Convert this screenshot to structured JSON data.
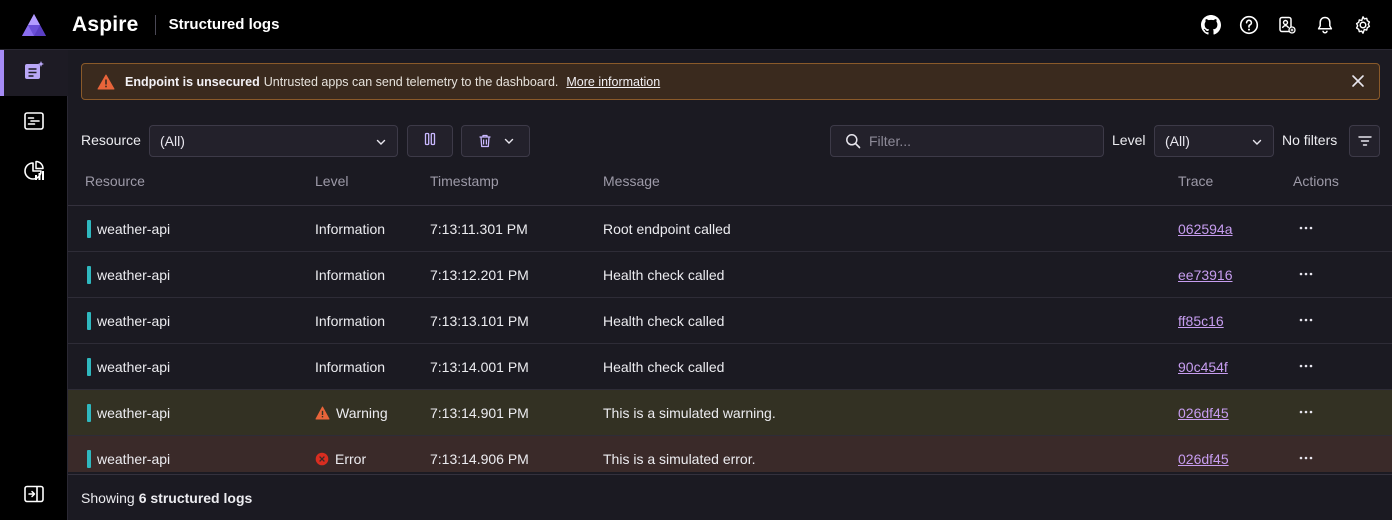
{
  "app": {
    "title": "Aspire",
    "page": "Structured logs"
  },
  "topbar_icons": [
    "github-icon",
    "help-icon",
    "settings-user-icon",
    "notification-bell-icon",
    "gear-icon"
  ],
  "sidebar": {
    "items": [
      {
        "name": "structured-logs",
        "icon": "structured-logs-icon",
        "active": true
      },
      {
        "name": "traces",
        "icon": "traces-icon",
        "active": false
      },
      {
        "name": "metrics",
        "icon": "metrics-icon",
        "active": false
      }
    ],
    "collapse_icon": "sidebar-collapse-icon"
  },
  "banner": {
    "title": "Endpoint is unsecured",
    "text": "Untrusted apps can send telemetry to the dashboard.",
    "link": "More information"
  },
  "toolbar": {
    "resource_label": "Resource",
    "resource_value": "(All)",
    "filter_placeholder": "Filter...",
    "level_label": "Level",
    "level_value": "(All)",
    "no_filters": "No filters"
  },
  "table": {
    "headers": {
      "resource": "Resource",
      "level": "Level",
      "timestamp": "Timestamp",
      "message": "Message",
      "trace": "Trace",
      "actions": "Actions"
    },
    "rows": [
      {
        "resource": "weather-api",
        "level": "Information",
        "timestamp": "7:13:11.301 PM",
        "message": "Root endpoint called",
        "trace": "062594a"
      },
      {
        "resource": "weather-api",
        "level": "Information",
        "timestamp": "7:13:12.201 PM",
        "message": "Health check called",
        "trace": "ee73916"
      },
      {
        "resource": "weather-api",
        "level": "Information",
        "timestamp": "7:13:13.101 PM",
        "message": "Health check called",
        "trace": "ff85c16"
      },
      {
        "resource": "weather-api",
        "level": "Information",
        "timestamp": "7:13:14.001 PM",
        "message": "Health check called",
        "trace": "90c454f"
      },
      {
        "resource": "weather-api",
        "level": "Warning",
        "timestamp": "7:13:14.901 PM",
        "message": "This is a simulated warning.",
        "trace": "026df45"
      },
      {
        "resource": "weather-api",
        "level": "Error",
        "timestamp": "7:13:14.906 PM",
        "message": "This is a simulated error.",
        "trace": "026df45"
      }
    ]
  },
  "footer": {
    "prefix": "Showing",
    "count_text": "6 structured logs"
  },
  "colors": {
    "accent": "#a58bf5",
    "resource_bar": "#2fb8bf",
    "trace_link": "#c79df0",
    "warning": "#e8643a",
    "error": "#d92d20",
    "warning_row": "#333123",
    "error_row": "#3a2a29"
  }
}
